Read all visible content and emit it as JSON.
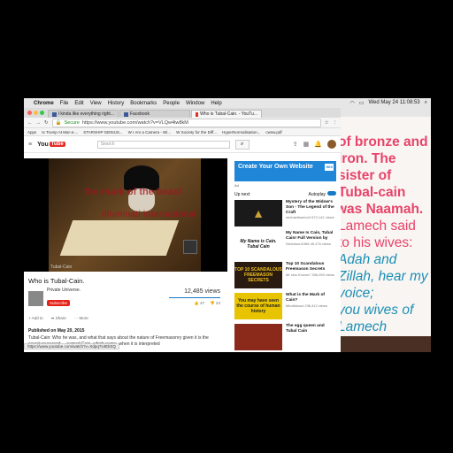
{
  "menubar": {
    "app": "Chrome",
    "items": [
      "File",
      "Edit",
      "View",
      "History",
      "Bookmarks",
      "People",
      "Window",
      "Help"
    ],
    "clock": "Wed May 24  11:08:53"
  },
  "tabs": [
    {
      "label": "I kinda like everything right..."
    },
    {
      "label": "Facebook"
    },
    {
      "label": "Who is Tubal-Cain. - YouTu..."
    }
  ],
  "address": {
    "secure": "Secure",
    "url": "https://www.youtube.com/watch?v=VLQw4tw8kM"
  },
  "bookmarks": [
    "Apps",
    "Is Trump At Mar-a-...",
    "STARSHIP GENIUS...",
    "W I Am a Camera - Wi...",
    "W Society for the Diff...",
    "HyperNormalisation...",
    "cwsw.pdf"
  ],
  "youtube": {
    "logo": "You",
    "logo_red": "Tube",
    "search_placeholder": "Search"
  },
  "video": {
    "overlay1": "the mark of the beast",
    "overlay2": "illuminati international",
    "corner_text": "Tubal-Cain",
    "title": "Who is Tubal-Cain.",
    "channel": "Private Universe.",
    "subscribe": "Subscribe",
    "views": "12,485 views",
    "add_to": "Add to",
    "share": "Share",
    "more": "More",
    "likes": "47",
    "dislikes": "24",
    "published": "Published on May 20, 2015",
    "description": "Tubal-Cain: Who he was, and what that says about the nature of Freemasonry given it is the secret password ... named Cain, which name, when it is interpreted",
    "status_url": "https://www.youtube.com/watch?v=Xdpq7s4EkSQ"
  },
  "sidebar": {
    "ad_title": "Create Your Own Website",
    "ad_brand": "WIX",
    "ad_sub": "Ad",
    "upnext": "Up next",
    "autoplay": "Autoplay",
    "recs": [
      {
        "thumb": "",
        "title": "Mystery of the Widow's Son - The Legend of the Craft",
        "meta": "michaeltsarion3\n672,142 views"
      },
      {
        "thumb": "My Name is Cain. Tubal Cain",
        "title": "My Name Is Cain, Tubal Cain! Full Version by",
        "meta": "Nicholson1968\n45,476 views"
      },
      {
        "thumb": "TOP 10 SCANDALOUS FREEMASON SECRETS",
        "title": "Top 10 Scandalous Freemason Secrets",
        "meta": "Mr sins Knows?\n356,059 views"
      },
      {
        "thumb": "You may have seen the course of human history",
        "title": "What is the Mark of Cain?",
        "meta": "Mindfulsoul\n236,412 views"
      },
      {
        "thumb": "",
        "title": "The egg queen and Tubal Cain",
        "meta": ""
      }
    ]
  },
  "verse": [
    {
      "text": "of bronze and",
      "style": "pink"
    },
    {
      "text": "iron. The",
      "style": "pink"
    },
    {
      "text": "sister of",
      "style": "pink"
    },
    {
      "text": "Tubal-cain",
      "style": "pink"
    },
    {
      "text": "was Naamah.",
      "style": "pink"
    },
    {
      "text": "Lamech said",
      "style": "pinkn"
    },
    {
      "text": "to his wives:",
      "style": "pinkn"
    },
    {
      "text": "Adah and",
      "style": "blue"
    },
    {
      "text": "Zillah, hear my",
      "style": "blue"
    },
    {
      "text": "voice;",
      "style": "blue"
    },
    {
      "text": "you wives of",
      "style": "blue"
    },
    {
      "text": "Lamech",
      "style": "blue"
    }
  ]
}
